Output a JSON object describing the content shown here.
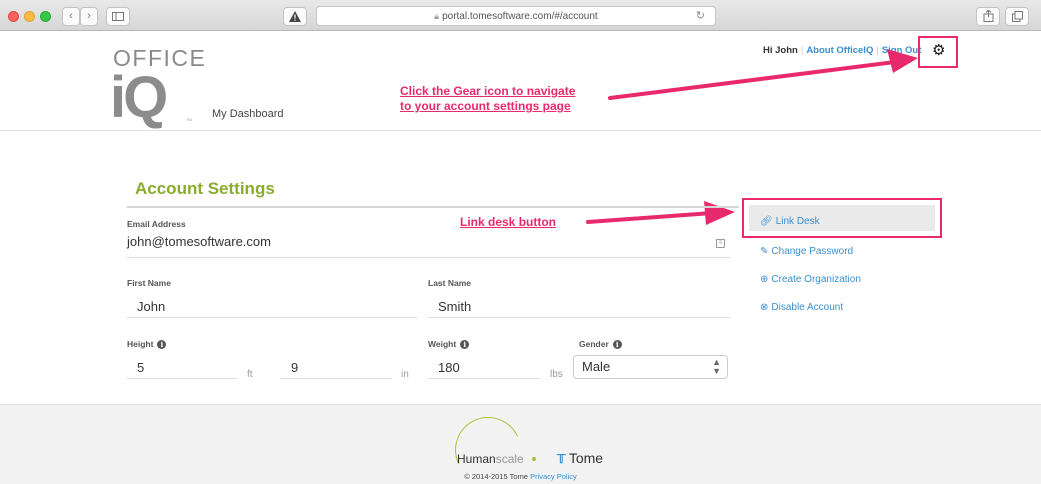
{
  "browser": {
    "url": "portal.tomesoftware.com/#/account",
    "nav_back": "‹",
    "nav_forward": "›"
  },
  "header": {
    "logo_top": "OFFICE",
    "logo_main": "iQ",
    "logo_tm": "TM",
    "dashboard_link": "My Dashboard",
    "greeting": "Hi John",
    "about_link": "About OfficeIQ",
    "signout_link": "Sign Out"
  },
  "annotations": {
    "gear_line1": "Click the Gear icon to navigate",
    "gear_line2": "to your account settings page",
    "link_desk": "Link desk button",
    "color": "#e8296b"
  },
  "account": {
    "title": "Account Settings",
    "email_label": "Email Address",
    "email_value": "john@tomesoftware.com",
    "first_name_label": "First Name",
    "first_name_value": "John",
    "last_name_label": "Last Name",
    "last_name_value": "Smith",
    "height_label": "Height",
    "height_ft": "5",
    "height_ft_unit": "ft",
    "height_in": "9",
    "height_in_unit": "in",
    "weight_label": "Weight",
    "weight_value": "180",
    "weight_unit": "lbs",
    "gender_label": "Gender",
    "gender_value": "Male"
  },
  "side_menu": {
    "items": [
      {
        "label": "Link Desk",
        "icon": "link-icon"
      },
      {
        "label": "Change Password",
        "icon": "pencil-icon"
      },
      {
        "label": "Create Organization",
        "icon": "plus-circle-icon"
      },
      {
        "label": "Disable Account",
        "icon": "x-circle-icon"
      }
    ]
  },
  "footer": {
    "humanscale_a": "Human",
    "humanscale_b": "scale",
    "tome": "Tome",
    "copyright": "© 2014-2015 Tome",
    "privacy": "Privacy Policy"
  },
  "colors": {
    "accent_green": "#8aab2e",
    "link_blue": "#3b8fcf",
    "highlight_pink": "#e8296b"
  }
}
